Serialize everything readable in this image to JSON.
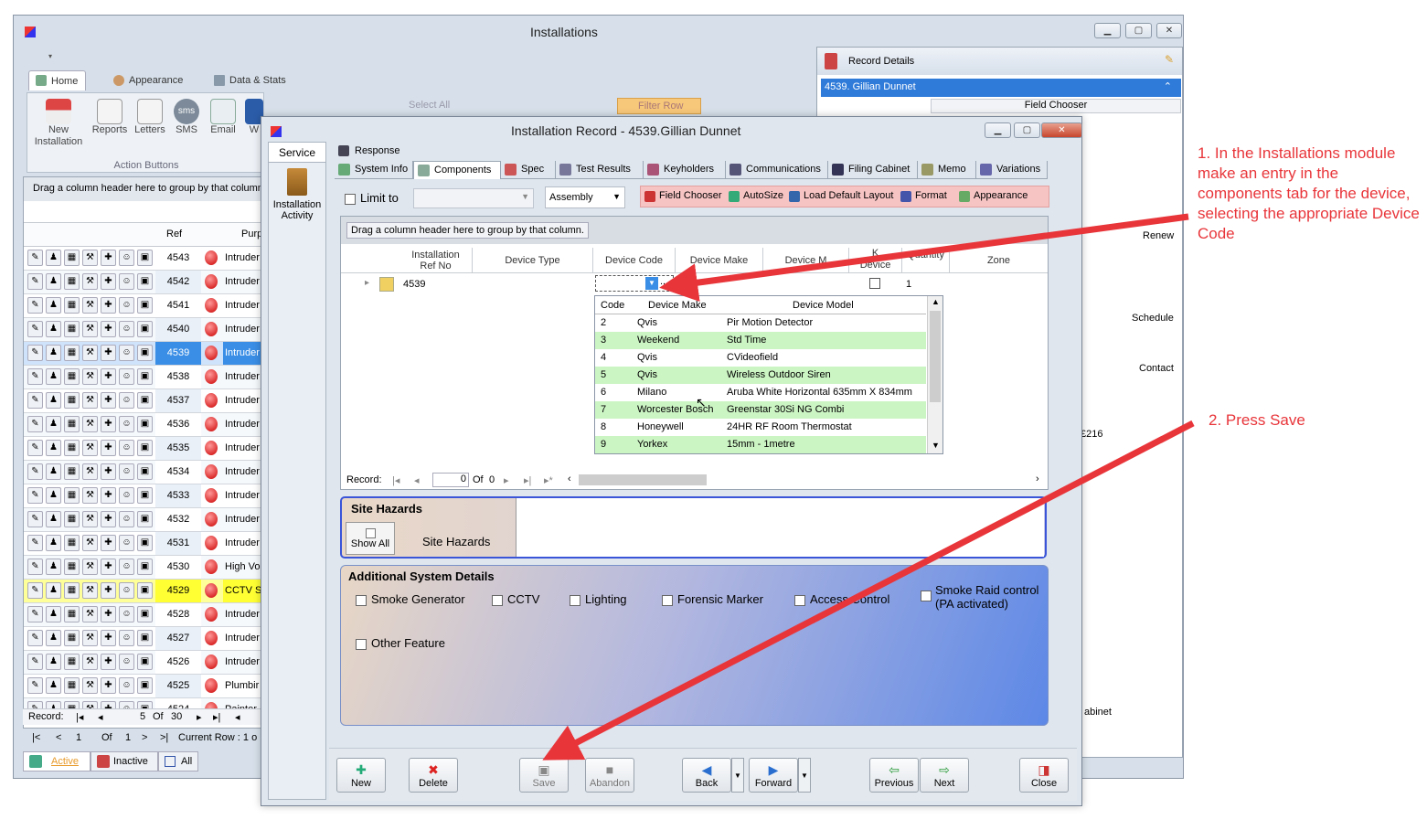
{
  "main_window": {
    "title": "Installations",
    "ribbon_tabs": [
      "Home",
      "Appearance",
      "Data & Stats"
    ],
    "ribbon_buttons": [
      {
        "label": "New\nInstallation",
        "icon": "house-icon"
      },
      {
        "label": "Reports",
        "icon": "report-icon"
      },
      {
        "label": "Letters",
        "icon": "letters-icon"
      },
      {
        "label": "SMS",
        "icon": "sms-icon"
      },
      {
        "label": "Email",
        "icon": "email-icon"
      },
      {
        "label": "W",
        "icon": "word-icon"
      }
    ],
    "select_all": "Select All",
    "filter_row": "Filter Row",
    "group_label": "Action Buttons",
    "drag_hint": "Drag a column header here to group by that column",
    "col_ref": "Ref",
    "col_purpose": "Purp",
    "rows": [
      {
        "ref": "4543",
        "purpose": "Intruder",
        "state": "normal"
      },
      {
        "ref": "4542",
        "purpose": "Intruder",
        "state": "alt"
      },
      {
        "ref": "4541",
        "purpose": "Intruder",
        "state": "normal"
      },
      {
        "ref": "4540",
        "purpose": "Intruder",
        "state": "alt"
      },
      {
        "ref": "4539",
        "purpose": "Intruder",
        "state": "selected"
      },
      {
        "ref": "4538",
        "purpose": "Intruder",
        "state": "normal"
      },
      {
        "ref": "4537",
        "purpose": "Intruder",
        "state": "alt"
      },
      {
        "ref": "4536",
        "purpose": "Intruder",
        "state": "normal"
      },
      {
        "ref": "4535",
        "purpose": "Intruder",
        "state": "alt"
      },
      {
        "ref": "4534",
        "purpose": "Intruder",
        "state": "normal"
      },
      {
        "ref": "4533",
        "purpose": "Intruder",
        "state": "alt"
      },
      {
        "ref": "4532",
        "purpose": "Intruder",
        "state": "normal"
      },
      {
        "ref": "4531",
        "purpose": "Intruder",
        "state": "alt"
      },
      {
        "ref": "4530",
        "purpose": "High Vo",
        "state": "normal"
      },
      {
        "ref": "4529",
        "purpose": "CCTV S",
        "state": "highlight"
      },
      {
        "ref": "4528",
        "purpose": "Intruder",
        "state": "normal"
      },
      {
        "ref": "4527",
        "purpose": "Intruder",
        "state": "alt"
      },
      {
        "ref": "4526",
        "purpose": "Intruder",
        "state": "normal"
      },
      {
        "ref": "4525",
        "purpose": "Plumbir",
        "state": "alt"
      },
      {
        "ref": "4524",
        "purpose": "Painter",
        "state": "normal"
      }
    ],
    "nav": {
      "record_label": "Record:",
      "current": "5",
      "of": "Of",
      "total": "30"
    },
    "nav2": {
      "first": "|<",
      "prev": "<",
      "page": "1",
      "of": "Of",
      "total": "1",
      "next": ">",
      "last": ">|",
      "current_row": "Current Row : 1 o"
    },
    "bottom_tabs": [
      "Active",
      "Inactive",
      "All"
    ]
  },
  "record_details": {
    "title": "Record Details",
    "selected": "4539. Gillian Dunnet",
    "field_chooser": "Field Chooser",
    "renew": "Renew",
    "schedule": "Schedule",
    "contact": "Contact",
    "amount": "£216",
    "cabinet": "abinet"
  },
  "dialog": {
    "title": "Installation Record - 4539.Gillian Dunnet",
    "side_tab": "Service",
    "side_item": "Installation\nActivity",
    "tabs_row1": [
      "Response"
    ],
    "tabs_row2": [
      "System Info",
      "Components",
      "Spec",
      "Test Results",
      "Keyholders",
      "Communications",
      "Filing Cabinet",
      "Memo",
      "Variations"
    ],
    "limit_to": "Limit to",
    "assembly": "Assembly",
    "toolbar": [
      "Field Chooser",
      "AutoSize",
      "Load Default Layout",
      "Format",
      "Appearance"
    ],
    "drag_hint": "Drag a column header here to group by that column.",
    "columns": [
      "Installation\nRef No",
      "Device Type",
      "Device Code",
      "Device Make",
      "Device M",
      "Device",
      "Quantity",
      "Zone"
    ],
    "col_k": "K",
    "row": {
      "ref": "4539",
      "quantity": "1"
    },
    "ellipsis": "...",
    "dropdown": {
      "headers": [
        "Code",
        "Device Make",
        "Device Model"
      ],
      "rows": [
        {
          "code": "2",
          "make": "Qvis",
          "model": "Pir Motion Detector"
        },
        {
          "code": "3",
          "make": "Weekend",
          "model": "Std Time"
        },
        {
          "code": "4",
          "make": "Qvis",
          "model": "CVideofield"
        },
        {
          "code": "5",
          "make": "Qvis",
          "model": "Wireless Outdoor Siren"
        },
        {
          "code": "6",
          "make": "Milano",
          "model": "Aruba White Horizontal 635mm X 834mm"
        },
        {
          "code": "7",
          "make": "Worcester Bosch",
          "model": "Greenstar 30Si NG Combi"
        },
        {
          "code": "8",
          "make": "Honeywell",
          "model": "24HR RF Room Thermostat"
        },
        {
          "code": "9",
          "make": "Yorkex",
          "model": "15mm - 1metre"
        }
      ]
    },
    "record_nav": {
      "label": "Record:",
      "value": "0",
      "of": "Of",
      "total": "0"
    },
    "site_hazards_title": "Site Hazards",
    "show_all": "Show All",
    "site_hazards_label": "Site Hazards",
    "additional_title": "Additional System Details",
    "features": [
      "Smoke Generator",
      "CCTV",
      "Lighting",
      "Forensic Marker",
      "Access Control",
      "Smoke Raid control\n(PA activated)",
      "Other Feature"
    ],
    "buttons": [
      "New",
      "Delete",
      "Save",
      "Abandon",
      "Back",
      "Forward",
      "Previous",
      "Next",
      "Close"
    ]
  },
  "annotations": {
    "note1": "1. In the Installations module make an entry in the components tab for the device, selecting the appropriate Device Code",
    "note2": "2. Press Save"
  },
  "colors": {
    "accent": "#3a8ee6",
    "annotation": "#e8353a",
    "row_green": "#ccf5c4",
    "highlight": "#ffff33"
  }
}
